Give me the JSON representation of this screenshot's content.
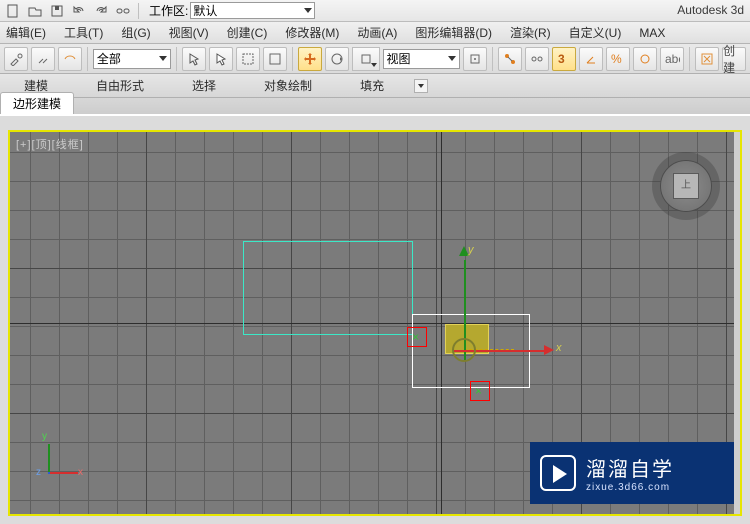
{
  "brand": "Autodesk 3d",
  "workspace": {
    "label": "工作区:",
    "value": "默认"
  },
  "menu": [
    "编辑(E)",
    "工具(T)",
    "组(G)",
    "视图(V)",
    "创建(C)",
    "修改器(M)",
    "动画(A)",
    "图形编辑器(D)",
    "渲染(R)",
    "自定义(U)",
    "MAX"
  ],
  "ribbon": {
    "filter": "全部",
    "reference": "视图",
    "last_btn": "创建"
  },
  "ribbontabs": [
    "建模",
    "自由形式",
    "选择",
    "对象绘制",
    "填充"
  ],
  "subtab": "边形建模",
  "viewport": {
    "label": "[+][顶][线框]"
  },
  "viewcube": {
    "face": "上"
  },
  "gizmo": {
    "xlabel": "x",
    "ylabel": "y"
  },
  "tripod": {
    "x": "x",
    "y": "y",
    "z": "z"
  },
  "watermark": {
    "title": "溜溜自学",
    "sub": "zixue.3d66.com"
  }
}
